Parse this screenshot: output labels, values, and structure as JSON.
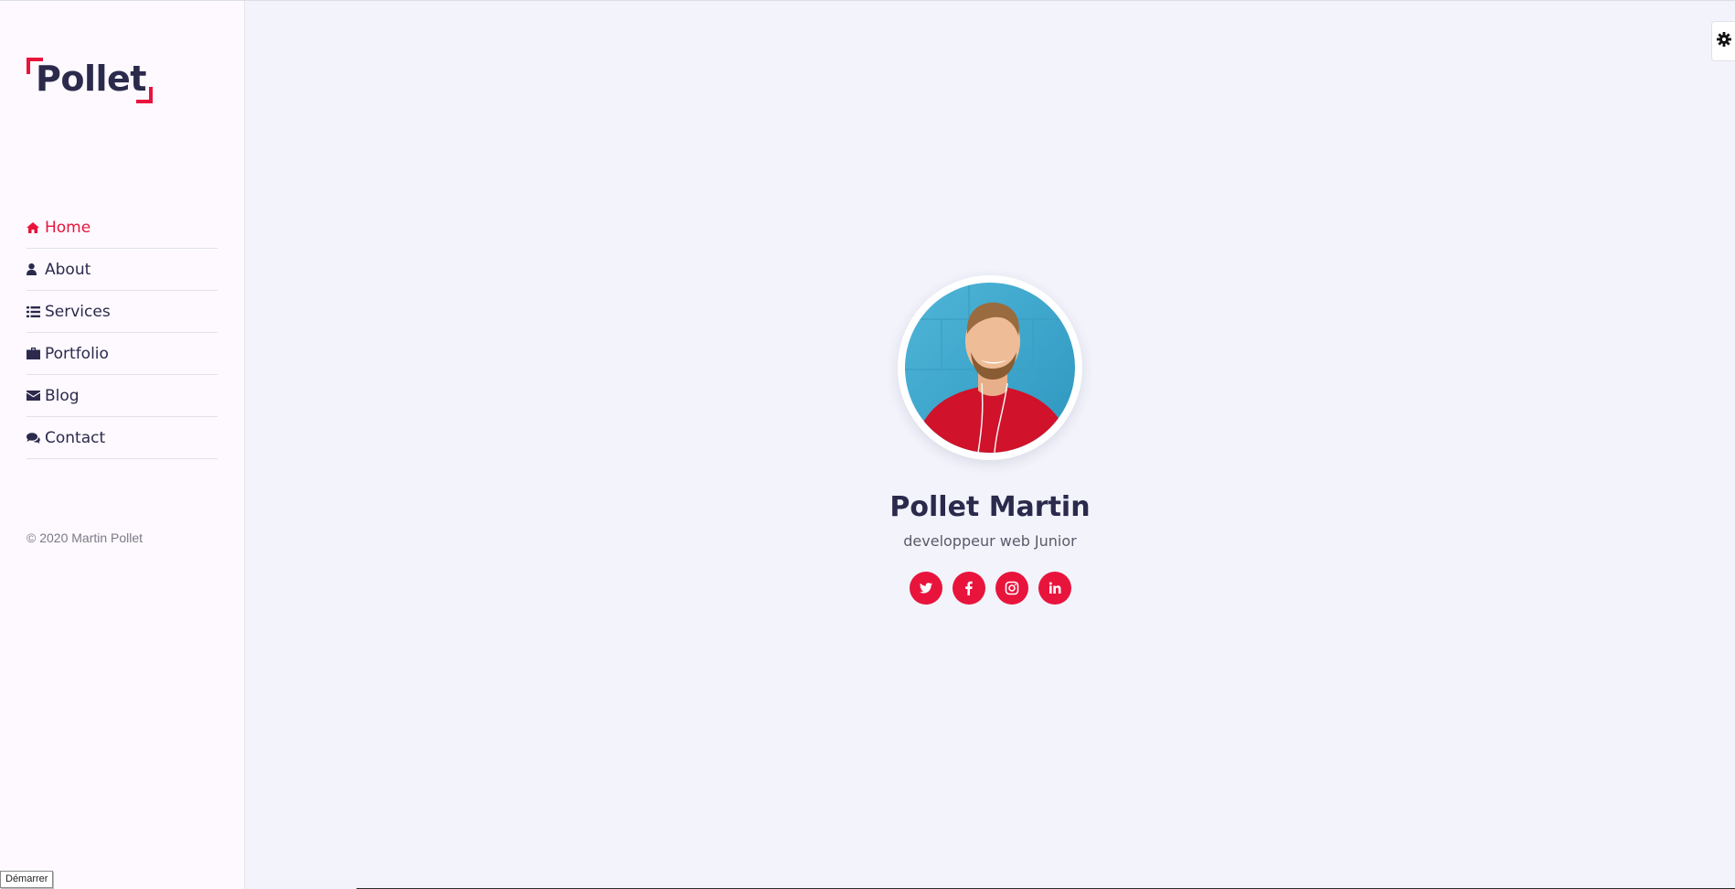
{
  "brand": {
    "logo_text": "Pollet",
    "accent": "#e8143c",
    "text_color": "#2b2a4c"
  },
  "sidebar": {
    "items": [
      {
        "label": "Home",
        "icon": "home-icon",
        "active": true
      },
      {
        "label": "About",
        "icon": "user-icon",
        "active": false
      },
      {
        "label": "Services",
        "icon": "list-icon",
        "active": false
      },
      {
        "label": "Portfolio",
        "icon": "briefcase-icon",
        "active": false
      },
      {
        "label": "Blog",
        "icon": "envelope-icon",
        "active": false
      },
      {
        "label": "Contact",
        "icon": "comments-icon",
        "active": false
      }
    ],
    "copyright": "© 2020 Martin Pollet"
  },
  "taskbar": {
    "start_label": "Démarrer"
  },
  "profile": {
    "name": "Pollet Martin",
    "role": "developpeur web Junior",
    "socials": [
      {
        "icon": "twitter-icon"
      },
      {
        "icon": "facebook-icon"
      },
      {
        "icon": "instagram-icon"
      },
      {
        "icon": "linkedin-icon"
      }
    ]
  },
  "settings": {
    "icon": "gear-icon"
  }
}
